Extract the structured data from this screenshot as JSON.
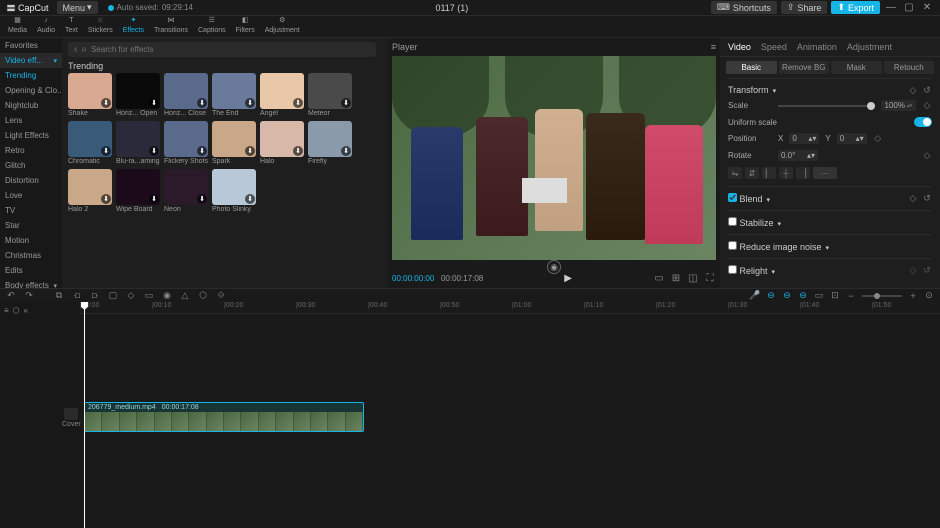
{
  "titlebar": {
    "app_name": "CapCut",
    "menu_label": "Menu",
    "autosave_label": "Auto saved:",
    "autosave_time": "09:29:14",
    "project_title": "0117 (1)",
    "shortcuts_label": "Shortcuts",
    "share_label": "Share",
    "export_label": "Export"
  },
  "toolbar": {
    "items": [
      {
        "label": "Media",
        "active": false
      },
      {
        "label": "Audio",
        "active": false
      },
      {
        "label": "Text",
        "active": false
      },
      {
        "label": "Stickers",
        "active": false
      },
      {
        "label": "Effects",
        "active": true
      },
      {
        "label": "Transitions",
        "active": false
      },
      {
        "label": "Captions",
        "active": false
      },
      {
        "label": "Filters",
        "active": false
      },
      {
        "label": "Adjustment",
        "active": false
      }
    ]
  },
  "categories": {
    "items": [
      {
        "label": "Favorites"
      },
      {
        "label": "Video eff...",
        "selected": true,
        "hasChev": true
      },
      {
        "label": "Trending",
        "highlight": true
      },
      {
        "label": "Opening & Clo..."
      },
      {
        "label": "Nightclub"
      },
      {
        "label": "Lens"
      },
      {
        "label": "Light Effects"
      },
      {
        "label": "Retro"
      },
      {
        "label": "Glitch"
      },
      {
        "label": "Distortion"
      },
      {
        "label": "Love"
      },
      {
        "label": "TV"
      },
      {
        "label": "Star"
      },
      {
        "label": "Motion"
      },
      {
        "label": "Christmas"
      },
      {
        "label": "Edits"
      },
      {
        "label": "Body effects",
        "hasChev": true
      }
    ]
  },
  "search": {
    "placeholder": "Search for effects"
  },
  "effects": {
    "section_label": "Trending",
    "items": [
      {
        "label": "Shake",
        "bg": "#d8a890"
      },
      {
        "label": "Horiz... Open",
        "bg": "#0a0a0a"
      },
      {
        "label": "Horiz... Close",
        "bg": "#5a6a8a"
      },
      {
        "label": "The End",
        "bg": "#6a7a9a"
      },
      {
        "label": "Angel",
        "bg": "#e8c8a8"
      },
      {
        "label": "Meteor",
        "bg": "#4a4a4a"
      },
      {
        "label": "Chromatic",
        "bg": "#3a5a7a"
      },
      {
        "label": "Blu-ra...aming",
        "bg": "#2a2a3a"
      },
      {
        "label": "Flickery Shots",
        "bg": "#5a6a8a"
      },
      {
        "label": "Spark",
        "bg": "#c8a888"
      },
      {
        "label": "Halo",
        "bg": "#d8b8a8"
      },
      {
        "label": "Firefly",
        "bg": "#8a9aaa"
      },
      {
        "label": "Halo 2",
        "bg": "#c8a888"
      },
      {
        "label": "Wipe Board",
        "bg": "#1a0a1a"
      },
      {
        "label": "Neon",
        "bg": "#2a1a2a"
      },
      {
        "label": "Photo Slinky",
        "bg": "#b8c8d8"
      }
    ]
  },
  "player": {
    "title": "Player",
    "current_time": "00:00:00:00",
    "duration": "00:00:17:08"
  },
  "props": {
    "tabs": [
      {
        "label": "Video",
        "active": true
      },
      {
        "label": "Speed"
      },
      {
        "label": "Animation"
      },
      {
        "label": "Adjustment"
      }
    ],
    "subtabs": [
      {
        "label": "Basic",
        "active": true
      },
      {
        "label": "Remove BG"
      },
      {
        "label": "Mask"
      },
      {
        "label": "Retouch"
      }
    ],
    "transform_label": "Transform",
    "scale_label": "Scale",
    "scale_value": "100%",
    "uniform_label": "Uniform scale",
    "position_label": "Position",
    "pos_x_label": "X",
    "pos_x_val": "0",
    "pos_y_label": "Y",
    "pos_y_val": "0",
    "rotate_label": "Rotate",
    "rotate_val": "0.0°",
    "blend_label": "Blend",
    "stabilize_label": "Stabilize",
    "reduce_label": "Reduce image noise",
    "relight_label": "Relight"
  },
  "timeline": {
    "ticks": [
      "00:00",
      "00:10",
      "00:20",
      "00:30",
      "00:40",
      "00:50",
      "01:00",
      "01:10",
      "01:20",
      "01:30",
      "01:40",
      "01:50"
    ],
    "cover_label": "Cover",
    "clip_name": "206779_medium.mp4",
    "clip_duration": "00:00:17:08"
  }
}
